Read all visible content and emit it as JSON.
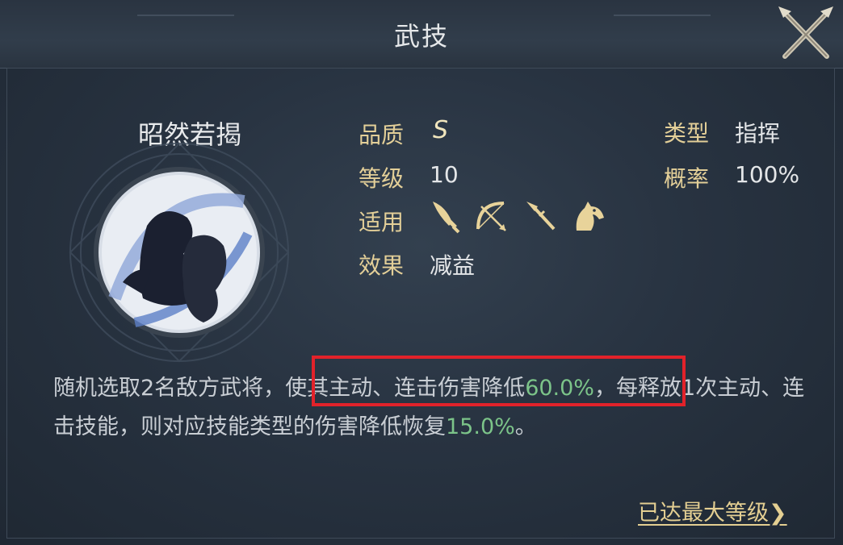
{
  "header": {
    "title": "武技",
    "close_icon": "close-crossed-swords-icon"
  },
  "skill": {
    "name": "昭然若揭",
    "emblem_icon": "warriors-silhouette-emblem-icon"
  },
  "attributes": {
    "quality_label": "品质",
    "quality_value": "S",
    "level_label": "等级",
    "level_value": "10",
    "applicable_label": "适用",
    "applicable_icons": [
      "saber-icon",
      "bow-icon",
      "spear-icon",
      "horse-icon"
    ],
    "effect_label": "效果",
    "effect_value": "减益",
    "type_label": "类型",
    "type_value": "指挥",
    "chance_label": "概率",
    "chance_value": "100%"
  },
  "description": {
    "part1": "随机选取2名敌方武将，",
    "part2": "使其主动、连击伤害降低",
    "value1": "60.0%",
    "part3": "，每释放1次主动、连击技能，则对应技能类型的伤害降低恢复",
    "value2": "15.0%",
    "part4": "。"
  },
  "footer": {
    "max_level_link": "已达最大等级",
    "arrow": "❯"
  },
  "colors": {
    "label_gold": "#e3cf98",
    "highlight_green": "#7cc489",
    "annotation_red": "#e2222a"
  }
}
